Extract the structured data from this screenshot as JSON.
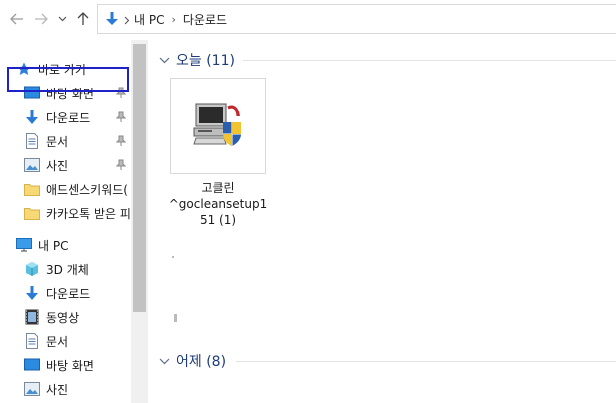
{
  "address": {
    "crumbs": [
      "내 PC",
      "다운로드"
    ]
  },
  "sidebar": {
    "quick_access": "바로 가기",
    "pinned": [
      {
        "label": "바탕 화면",
        "icon": "desktop-icon",
        "pinned": true
      },
      {
        "label": "다운로드",
        "icon": "download-icon",
        "pinned": true,
        "selected": true
      },
      {
        "label": "문서",
        "icon": "document-icon",
        "pinned": true
      },
      {
        "label": "사진",
        "icon": "pictures-icon",
        "pinned": true
      },
      {
        "label": "애드센스키워드(",
        "icon": "folder-icon",
        "pinned": false
      },
      {
        "label": "카카오톡 받은 피",
        "icon": "folder-icon",
        "pinned": false
      }
    ],
    "this_pc": "내 PC",
    "pc_items": [
      {
        "label": "3D 개체",
        "icon": "3d-objects-icon"
      },
      {
        "label": "다운로드",
        "icon": "download-icon"
      },
      {
        "label": "동영상",
        "icon": "video-icon"
      },
      {
        "label": "문서",
        "icon": "document-icon"
      },
      {
        "label": "바탕 화면",
        "icon": "desktop-icon"
      },
      {
        "label": "사진",
        "icon": "pictures-icon"
      }
    ]
  },
  "content": {
    "groups": [
      {
        "label": "오늘 (11)"
      },
      {
        "label": "어제 (8)"
      }
    ],
    "file": {
      "name_lines": [
        "고클린",
        "^gocleansetup1",
        "51 (1)"
      ],
      "icon": "installer-computer-shield-icon"
    }
  },
  "colors": {
    "selection_border": "#1e22c8",
    "group_text": "#1e3c78",
    "folder_yellow": "#f8d775",
    "download_blue": "#2a7bd6"
  }
}
